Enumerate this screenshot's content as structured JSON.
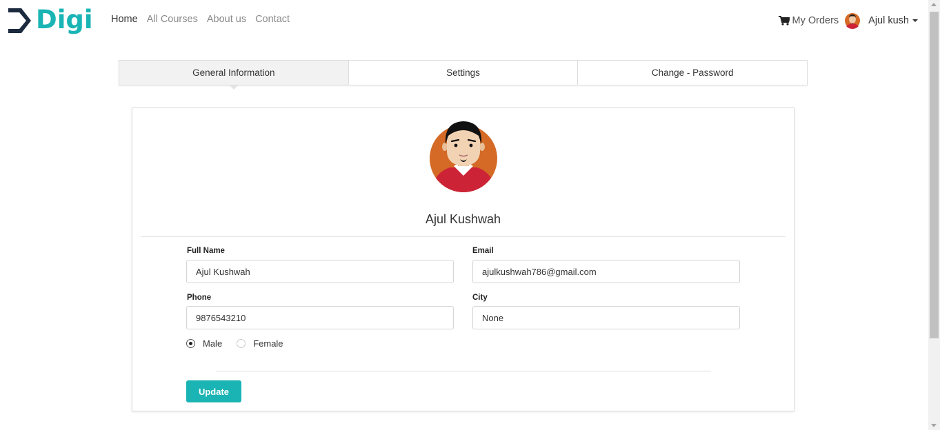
{
  "brand": {
    "name": "Digi",
    "color": "#1ab4b4",
    "mark_color": "#1c2a3f"
  },
  "nav": {
    "links": [
      {
        "label": "Home",
        "active": true
      },
      {
        "label": "All Courses",
        "active": false
      },
      {
        "label": "About us",
        "active": false
      },
      {
        "label": "Contact",
        "active": false
      }
    ],
    "orders_label": "My Orders",
    "orders_icon": "shopping-cart-icon",
    "user_name": "Ajul kush",
    "user_menu_icon": "caret-down-icon"
  },
  "tabs": [
    {
      "label": "General Information",
      "active": true
    },
    {
      "label": "Settings",
      "active": false
    },
    {
      "label": "Change - Password",
      "active": false
    }
  ],
  "profile": {
    "name": "Ajul Kushwah",
    "fields": {
      "full_name": {
        "label": "Full Name",
        "value": "Ajul Kushwah"
      },
      "email": {
        "label": "Email",
        "value": "ajulkushwah786@gmail.com"
      },
      "phone": {
        "label": "Phone",
        "value": "9876543210"
      },
      "city": {
        "label": "City",
        "value": "None"
      }
    },
    "gender": {
      "options": [
        "Male",
        "Female"
      ],
      "selected": "Male"
    },
    "update_label": "Update"
  },
  "colors": {
    "accent": "#1ab4b4",
    "avatar_bg": "#d46a25",
    "avatar_shirt": "#cc2336"
  }
}
